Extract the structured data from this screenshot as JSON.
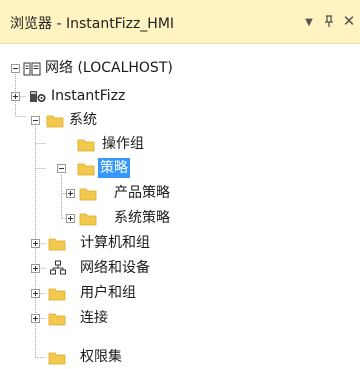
{
  "panel": {
    "title": "浏览器 - InstantFizz_HMI",
    "dropdown_glyph": "▼",
    "pin_glyph": "ⵖ",
    "close_glyph": "✕"
  },
  "colors": {
    "header_bg": "#fff3c1",
    "folder": "#f2c94c",
    "selection": "#3399ff"
  },
  "tree": {
    "nodes": [
      {
        "id": "root",
        "label": "网络 (LOCALHOST)",
        "icon": "network-server-icon",
        "expanded": true
      },
      {
        "id": "instantfizz",
        "label": "InstantFizz",
        "icon": "application-gear-icon",
        "expanded": false
      },
      {
        "id": "system",
        "label": "系统",
        "icon": "folder-icon",
        "expanded": true
      },
      {
        "id": "operation-group",
        "label": "操作组",
        "icon": "folder-icon",
        "expanded": null
      },
      {
        "id": "strategy",
        "label": "策略",
        "icon": "folder-icon",
        "expanded": true,
        "selected": true
      },
      {
        "id": "product-strategy",
        "label": "产品策略",
        "icon": "folder-icon",
        "expanded": false
      },
      {
        "id": "system-strategy",
        "label": "系统策略",
        "icon": "folder-icon",
        "expanded": false
      },
      {
        "id": "computers-groups",
        "label": "计算机和组",
        "icon": "folder-icon",
        "expanded": false
      },
      {
        "id": "network-devices",
        "label": "网络和设备",
        "icon": "network-topology-icon",
        "expanded": false
      },
      {
        "id": "users-groups",
        "label": "用户和组",
        "icon": "folder-icon",
        "expanded": false
      },
      {
        "id": "connections",
        "label": "连接",
        "icon": "folder-icon",
        "expanded": false
      },
      {
        "id": "permission-sets",
        "label": "权限集",
        "icon": "folder-icon",
        "expanded": null
      }
    ]
  }
}
